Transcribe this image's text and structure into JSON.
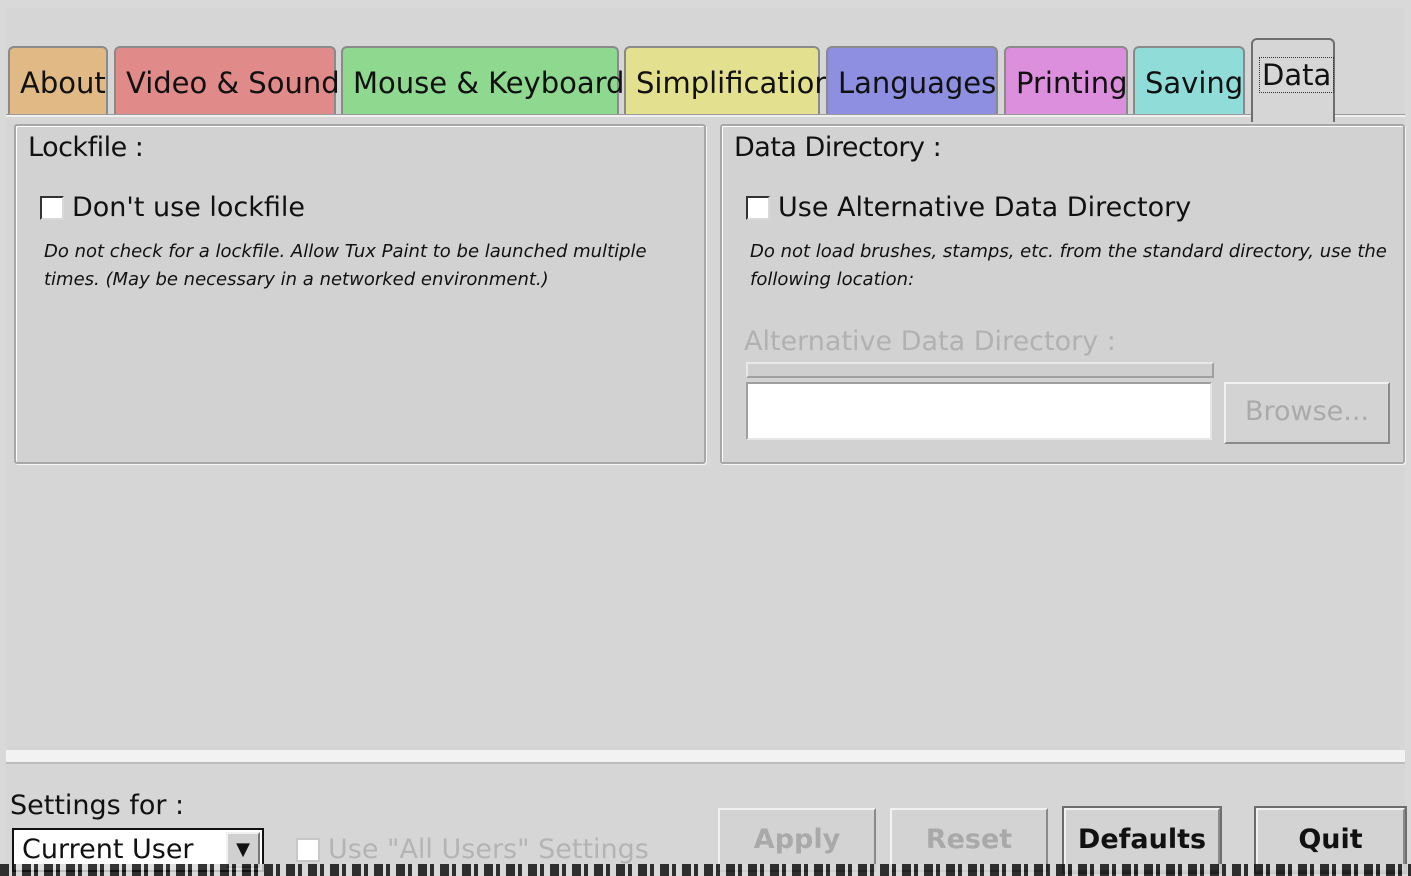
{
  "tabs": [
    {
      "label": "About",
      "color": "#e0b985"
    },
    {
      "label": "Video & Sound",
      "color": "#e08a8a"
    },
    {
      "label": "Mouse & Keyboard",
      "color": "#8fd890"
    },
    {
      "label": "Simplification",
      "color": "#e3e08f"
    },
    {
      "label": "Languages",
      "color": "#8e8fe0"
    },
    {
      "label": "Printing",
      "color": "#dc8fdc"
    },
    {
      "label": "Saving",
      "color": "#8fdcd8"
    },
    {
      "label": "Data",
      "color": "#d6d6d6",
      "active": true
    }
  ],
  "lockfile": {
    "title": "Lockfile :",
    "checkbox_label": "Don't use lockfile",
    "checked": false,
    "description": "Do not check for a lockfile. Allow Tux Paint to be launched multiple times. (May be necessary in a networked environment.)"
  },
  "data_directory": {
    "title": "Data Directory :",
    "checkbox_label": "Use Alternative Data Directory",
    "checked": false,
    "description": "Do not load brushes, stamps, etc. from the standard directory, use the following location:",
    "field_label": "Alternative Data Directory :",
    "field_value": "",
    "browse_label": "Browse..."
  },
  "footer": {
    "settings_for_label": "Settings for :",
    "settings_for_value": "Current User",
    "all_users_label": "Use \"All Users\" Settings",
    "apply_label": "Apply",
    "reset_label": "Reset",
    "defaults_label": "Defaults",
    "quit_label": "Quit"
  }
}
